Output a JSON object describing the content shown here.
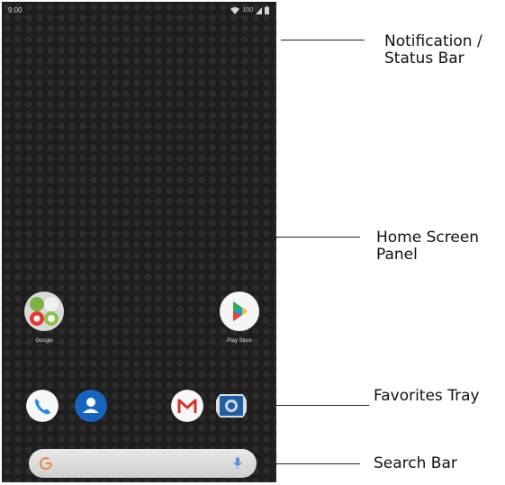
{
  "status_bar": {
    "time": "9:00",
    "signal_text": "100",
    "icons": [
      "wifi-icon",
      "signal-icon",
      "battery-icon"
    ]
  },
  "home": {
    "apps": [
      {
        "label": "Google",
        "icon": "google-folder-icon"
      },
      {
        "label": "Play Store",
        "icon": "play-store-icon"
      }
    ],
    "favorites_tray": [
      {
        "icon": "phone-icon",
        "color": "#1e88e5"
      },
      {
        "icon": "contacts-icon",
        "color": "#1565c0"
      },
      {
        "icon": "gmail-icon",
        "color": "#d93025"
      },
      {
        "icon": "camera-icon",
        "color": "#1e5fa8"
      }
    ],
    "search_bar": {
      "left_icon": "google-g-icon",
      "right_icon": "mic-icon"
    }
  },
  "callouts": [
    {
      "lines": [
        "Notification /",
        "Status Bar"
      ]
    },
    {
      "lines": [
        "Home Screen",
        "Panel"
      ]
    },
    {
      "lines": [
        "Favorites Tray"
      ]
    },
    {
      "lines": [
        "Search Bar"
      ]
    }
  ]
}
